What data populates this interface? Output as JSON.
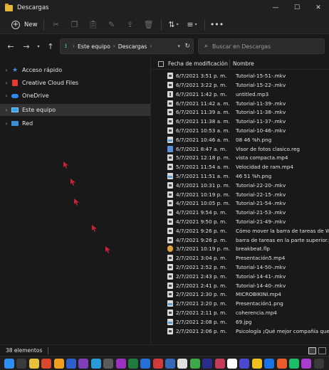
{
  "window": {
    "title": "Descargas",
    "controls": [
      "—",
      "☐",
      "✕"
    ]
  },
  "toolbar": {
    "new_label": "New",
    "icons": [
      "cut-icon",
      "copy-icon",
      "paste-icon",
      "rename-icon",
      "share-icon",
      "delete-icon",
      "sort-icon",
      "view-icon",
      "more-icon"
    ]
  },
  "address": {
    "segments": [
      "Este equipo",
      "Descargas"
    ],
    "search_placeholder": "Buscar en Descargas"
  },
  "sidebar": {
    "items": [
      {
        "label": "Acceso rápido",
        "icon": "star-icon"
      },
      {
        "label": "Creative Cloud Files",
        "icon": "creative-cloud-icon"
      },
      {
        "label": "OneDrive",
        "icon": "onedrive-icon"
      },
      {
        "label": "Este equipo",
        "icon": "this-pc-icon",
        "selected": true
      },
      {
        "label": "Red",
        "icon": "network-icon"
      }
    ]
  },
  "columns": {
    "date": "Fecha de modificación",
    "name": "Nombre"
  },
  "files": [
    {
      "date": "6/7/2021 3:51 p. m.",
      "name": "Tutorial-15-51-.mkv",
      "type": "mkv"
    },
    {
      "date": "6/7/2021 3:22 p. m.",
      "name": "Tutorial-15-22-.mkv",
      "type": "mkv"
    },
    {
      "date": "6/7/2021 1:42 p. m.",
      "name": "untitled.mp3",
      "type": "mp3"
    },
    {
      "date": "6/7/2021 11:42 a. m.",
      "name": "Tutorial-11-39-.mkv",
      "type": "mkv"
    },
    {
      "date": "6/7/2021 11:39 a. m.",
      "name": "Tutorial-11-38-.mkv",
      "type": "mkv"
    },
    {
      "date": "6/7/2021 11:38 a. m.",
      "name": "Tutorial-11-37-.mkv",
      "type": "mkv"
    },
    {
      "date": "6/7/2021 10:53 a. m.",
      "name": "Tutorial-10-46-.mkv",
      "type": "mkv"
    },
    {
      "date": "6/7/2021 10:46 a. m.",
      "name": "08 46 %h.png",
      "type": "png"
    },
    {
      "date": "6/7/2021 8:47 a. m.",
      "name": "Visor de fotos clasico.reg",
      "type": "reg"
    },
    {
      "date": "5/7/2021 12:18 p. m.",
      "name": "vista compacta.mp4",
      "type": "mp4"
    },
    {
      "date": "5/7/2021 11:54 a. m.",
      "name": "Velocidad de ram.mp4",
      "type": "mp4"
    },
    {
      "date": "5/7/2021 11:51 a. m.",
      "name": "46 51 %h.png",
      "type": "png"
    },
    {
      "date": "4/7/2021 10:31 p. m.",
      "name": "Tutorial-22-20-.mkv",
      "type": "mkv"
    },
    {
      "date": "4/7/2021 10:19 p. m.",
      "name": "Tutorial-22-15-.mkv",
      "type": "mkv"
    },
    {
      "date": "4/7/2021 10:05 p. m.",
      "name": "Tutorial-21-54-.mkv",
      "type": "mkv"
    },
    {
      "date": "4/7/2021 9:54 p. m.",
      "name": "Tutorial-21-53-.mkv",
      "type": "mkv"
    },
    {
      "date": "4/7/2021 9:50 p. m.",
      "name": "Tutorial-21-49-.mkv",
      "type": "mkv"
    },
    {
      "date": "4/7/2021 9:26 p. m.",
      "name": "Cómo mover la barra de tareas de Windo",
      "type": "mp4"
    },
    {
      "date": "4/7/2021 9:26 p. m.",
      "name": "barra de tareas en la parte superior.mp4",
      "type": "mp4"
    },
    {
      "date": "3/7/2021 10:19 p. m.",
      "name": "breakbeat.flp",
      "type": "flp"
    },
    {
      "date": "2/7/2021 3:04 p. m.",
      "name": "Presentación5.mp4",
      "type": "mp4"
    },
    {
      "date": "2/7/2021 2:52 p. m.",
      "name": "Tutorial-14-50-.mkv",
      "type": "mkv"
    },
    {
      "date": "2/7/2021 2:43 p. m.",
      "name": "Tutorial-14-41-.mkv",
      "type": "mkv"
    },
    {
      "date": "2/7/2021 2:41 p. m.",
      "name": "Tutorial-14-40-.mkv",
      "type": "mkv"
    },
    {
      "date": "2/7/2021 2:30 p. m.",
      "name": "MICROBIKINI.mp4",
      "type": "mp4"
    },
    {
      "date": "2/7/2021 2:20 p. m.",
      "name": "Presentación1.png",
      "type": "png"
    },
    {
      "date": "2/7/2021 2:11 p. m.",
      "name": "coherencia.mp4",
      "type": "mp4"
    },
    {
      "date": "2/7/2021 2:08 p. m.",
      "name": "69.jpg",
      "type": "png"
    },
    {
      "date": "2/7/2021 2:06 p. m.",
      "name": "Psicología ¡Qué mejor compañía que tu",
      "type": "mp4"
    }
  ],
  "status": {
    "count_text": "38 elementos"
  },
  "taskbar": {
    "apps": [
      "#2f8ff0",
      "#3a3a3a",
      "#e8c13a",
      "#d9482e",
      "#f0a020",
      "#2b5fc9",
      "#7e3fb8",
      "#2a9bd8",
      "#5a5a5a",
      "#9b2fc0",
      "#1f7a3d",
      "#2470d8",
      "#d13a3a",
      "#3568b8",
      "#e0e0e0",
      "#3da84a",
      "#2b2b8a",
      "#c63b5a",
      "#ffffff",
      "#4a4ad0",
      "#f0c020",
      "#1a73e8",
      "#ec5c2a",
      "#1ebd6a",
      "#a83dd0",
      "#3a3a3a"
    ]
  }
}
